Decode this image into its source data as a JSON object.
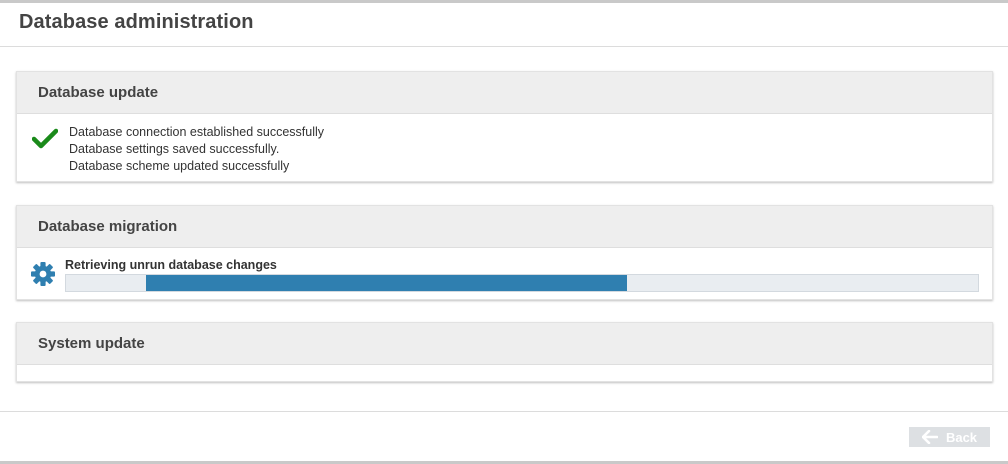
{
  "page": {
    "title": "Database administration"
  },
  "panels": {
    "database_update": {
      "title": "Database update",
      "status_icon": "check-icon",
      "status_color": "#1a8a1a",
      "messages": [
        "Database connection established successfully",
        "Database settings saved successfully.",
        "Database scheme updated successfully"
      ]
    },
    "database_migration": {
      "title": "Database migration",
      "status_icon": "gear-icon",
      "icon_color": "#2f7fb0",
      "progress_label": "Retrieving unrun database changes",
      "progress": {
        "start_fraction": 0.088,
        "end_fraction": 0.615,
        "bar_color": "#2f7fb0"
      }
    },
    "system_update": {
      "title": "System update"
    }
  },
  "footer": {
    "back_label": "Back",
    "back_icon": "arrow-left-icon"
  }
}
